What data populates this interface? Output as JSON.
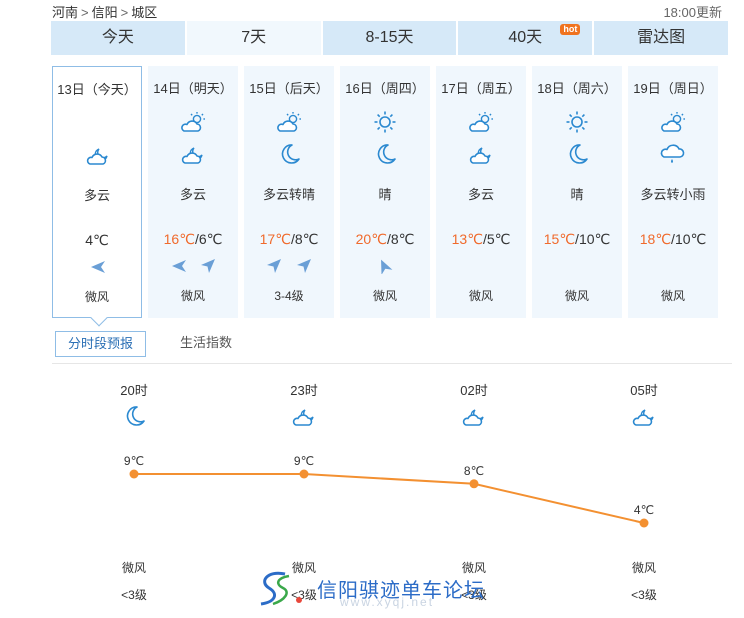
{
  "breadcrumb": {
    "province": "河南",
    "city": "信阳",
    "district": "城区",
    "sep": ">"
  },
  "updated": "18:00更新",
  "tabs": [
    {
      "label": "今天"
    },
    {
      "label": "7天"
    },
    {
      "label": "8-15天"
    },
    {
      "label": "40天",
      "badge": "hot"
    },
    {
      "label": "雷达图"
    }
  ],
  "days": [
    {
      "date": "13日（今天）",
      "icons": [
        "cloudy-night-icon"
      ],
      "cond": "多云",
      "hi": "",
      "lo": "4℃",
      "winds": [
        "wind-west-icon"
      ],
      "wind": "微风"
    },
    {
      "date": "14日（明天）",
      "icons": [
        "partly-cloudy-day-icon",
        "cloudy-night-icon"
      ],
      "cond": "多云",
      "hi": "16℃",
      "lo": "6℃",
      "winds": [
        "wind-west-icon",
        "wind-northeast-icon"
      ],
      "wind": "微风"
    },
    {
      "date": "15日（后天）",
      "icons": [
        "partly-cloudy-day-icon",
        "moon-icon"
      ],
      "cond": "多云转晴",
      "hi": "17℃",
      "lo": "8℃",
      "winds": [
        "wind-northeast-icon",
        "wind-northeast-icon"
      ],
      "wind": "3-4级"
    },
    {
      "date": "16日（周四）",
      "icons": [
        "sun-icon",
        "moon-icon"
      ],
      "cond": "晴",
      "hi": "20℃",
      "lo": "8℃",
      "winds": [
        "wind-north-icon"
      ],
      "wind": "微风"
    },
    {
      "date": "17日（周五）",
      "icons": [
        "partly-cloudy-day-icon",
        "cloudy-night-icon"
      ],
      "cond": "多云",
      "hi": "13℃",
      "lo": "5℃",
      "winds": [],
      "wind": "微风"
    },
    {
      "date": "18日（周六）",
      "icons": [
        "sun-icon",
        "moon-icon"
      ],
      "cond": "晴",
      "hi": "15℃",
      "lo": "10℃",
      "winds": [],
      "wind": "微风"
    },
    {
      "date": "19日（周日）",
      "icons": [
        "partly-cloudy-day-icon",
        "light-rain-icon"
      ],
      "cond": "多云转小雨",
      "hi": "18℃",
      "lo": "10℃",
      "winds": [],
      "wind": "微风"
    }
  ],
  "temp_sep": "/",
  "subtabs": [
    {
      "label": "分时段预报"
    },
    {
      "label": "生活指数"
    }
  ],
  "hourly": [
    {
      "time": "20时",
      "icon": "moon-icon",
      "temp": "9℃",
      "wind": "微风",
      "level": "<3级"
    },
    {
      "time": "23时",
      "icon": "cloudy-night-icon",
      "temp": "9℃",
      "wind": "微风",
      "level": "<3级"
    },
    {
      "time": "02时",
      "icon": "cloudy-night-icon",
      "temp": "8℃",
      "wind": "微风",
      "level": "<3级"
    },
    {
      "time": "05时",
      "icon": "cloudy-night-icon",
      "temp": "4℃",
      "wind": "微风",
      "level": "<3级"
    }
  ],
  "chart_data": {
    "type": "line",
    "x": [
      "20时",
      "23时",
      "02时",
      "05时"
    ],
    "series": [
      {
        "values": [
          9,
          9,
          8,
          4
        ]
      }
    ],
    "unit": "℃",
    "color": "#f39031"
  },
  "watermark": {
    "text": "信阳骐迹单车论坛",
    "url": "www.xyqj.net"
  },
  "colors": {
    "tab_bg": "#d6e9f8",
    "tab_active_bg": "#f1f8fd",
    "day_bg": "#f0f7fd",
    "hi_temp": "#f06a2c",
    "icon_blue": "#2b89d0",
    "wind_arrow": "#6a9fd6",
    "line": "#f39031"
  }
}
